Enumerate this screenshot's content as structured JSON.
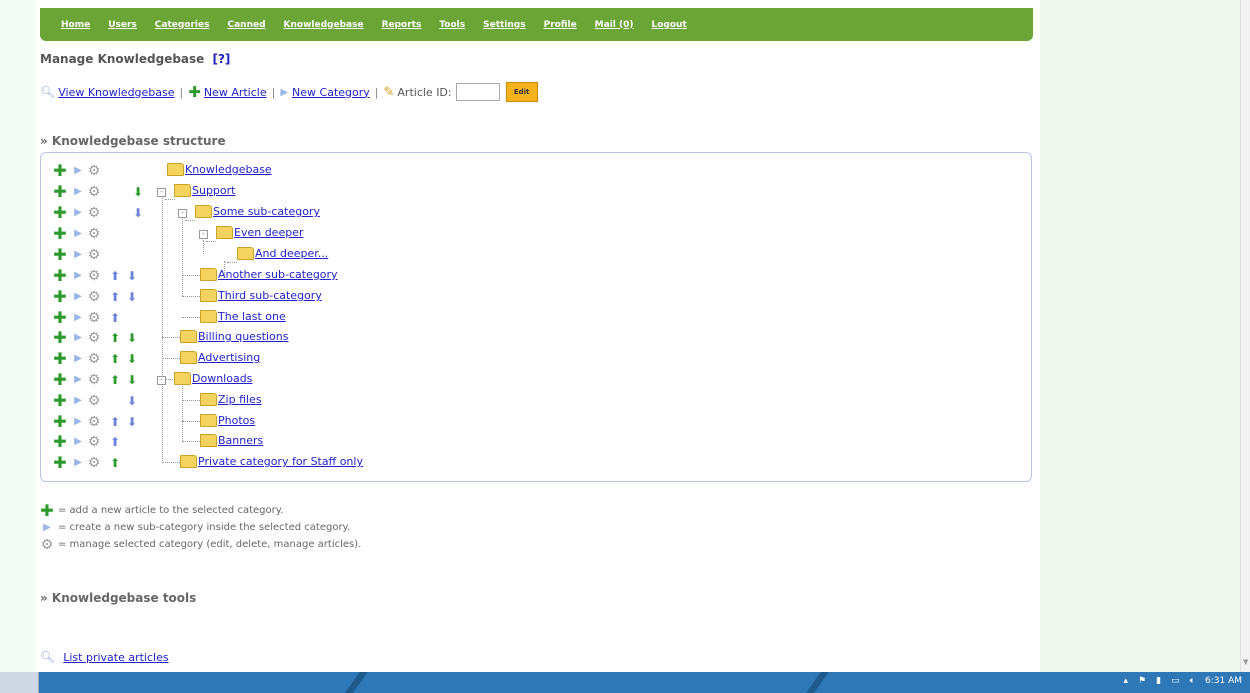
{
  "nav": {
    "items": [
      "Home",
      "Users",
      "Categories",
      "Canned",
      "Knowledgebase",
      "Reports",
      "Tools",
      "Settings",
      "Profile",
      "Mail (0)",
      "Logout"
    ]
  },
  "page": {
    "title": "Manage Knowledgebase",
    "help_link": "[?]"
  },
  "toolbar": {
    "view_label": "View Knowledgebase",
    "new_article_label": "New Article",
    "new_category_label": "New Category",
    "article_id_label": "Article ID:",
    "article_id_value": "",
    "edit_label": "Edit",
    "separator": "|"
  },
  "structure": {
    "heading": "» Knowledgebase structure",
    "nodes": [
      {
        "label": "Knowledgebase",
        "up": "",
        "down": ""
      },
      {
        "label": "Support",
        "up": "",
        "down": "green"
      },
      {
        "label": "Some sub-category",
        "up": "",
        "down": "blue"
      },
      {
        "label": "Even deeper",
        "up": "",
        "down": ""
      },
      {
        "label": "And deeper...",
        "up": "",
        "down": ""
      },
      {
        "label": "Another sub-category",
        "up": "blue",
        "down": "blue"
      },
      {
        "label": "Third sub-category",
        "up": "blue",
        "down": "blue"
      },
      {
        "label": "The last one",
        "up": "blue",
        "down": ""
      },
      {
        "label": "Billing questions",
        "up": "green",
        "down": "green"
      },
      {
        "label": "Advertising",
        "up": "green",
        "down": "green"
      },
      {
        "label": "Downloads",
        "up": "green",
        "down": "green"
      },
      {
        "label": "Zip files",
        "up": "",
        "down": "blue"
      },
      {
        "label": "Photos",
        "up": "blue",
        "down": "blue"
      },
      {
        "label": "Banners",
        "up": "blue",
        "down": ""
      },
      {
        "label": "Private category for Staff only",
        "up": "green",
        "down": ""
      }
    ]
  },
  "legend": {
    "add_article": "= add a new article to the selected category.",
    "new_subcategory": "= create a new sub-category inside the selected category.",
    "manage_category": "= manage selected category (edit, delete, manage articles)."
  },
  "tools": {
    "heading": "» Knowledgebase tools",
    "list_private_label": "List private articles"
  },
  "taskbar": {
    "clock": "6:31 AM"
  },
  "colors": {
    "nav_bg": "#6aa536",
    "link": "#2222cc",
    "edit_button": "#f6b21a",
    "taskbar": "#2f78b8"
  },
  "icons": {
    "add": "plus-icon",
    "subcategory": "triangle-icon",
    "manage": "gear-icon",
    "view": "magnifier-icon",
    "article_id": "pencil-icon"
  }
}
